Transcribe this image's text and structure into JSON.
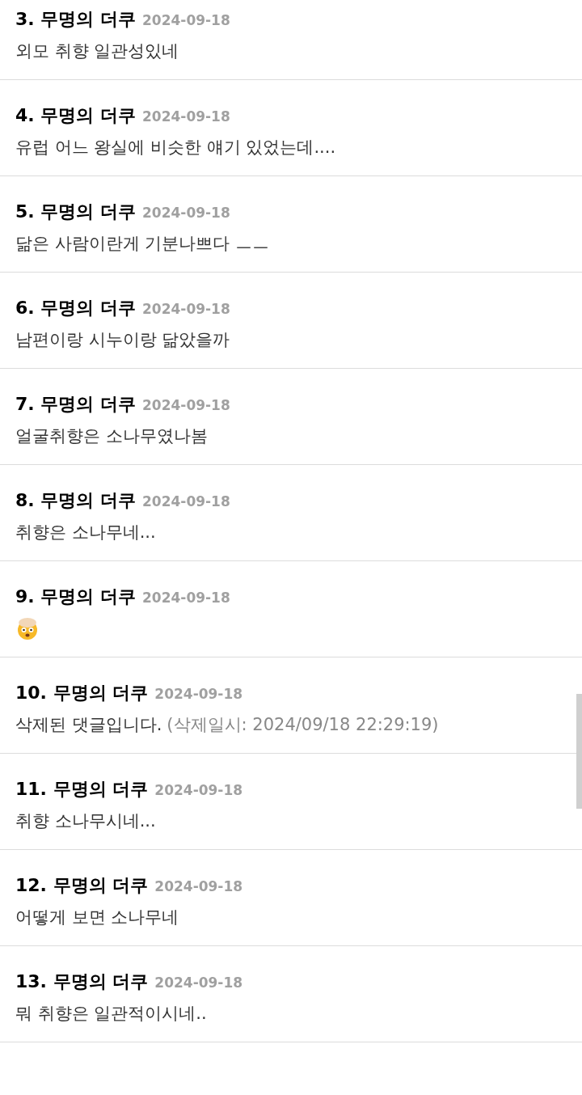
{
  "comments": [
    {
      "number": "3.",
      "author": "무명의 더쿠",
      "date": "2024-09-18",
      "kind": "text",
      "body": "외모 취향 일관성있네"
    },
    {
      "number": "4.",
      "author": "무명의 더쿠",
      "date": "2024-09-18",
      "kind": "text",
      "body": "유럽 어느 왕실에 비슷한 얘기 있었는데...."
    },
    {
      "number": "5.",
      "author": "무명의 더쿠",
      "date": "2024-09-18",
      "kind": "text",
      "body": "닮은 사람이란게 기분나쁘다 ㅡㅡ"
    },
    {
      "number": "6.",
      "author": "무명의 더쿠",
      "date": "2024-09-18",
      "kind": "text",
      "body": "남편이랑 시누이랑 닮았을까"
    },
    {
      "number": "7.",
      "author": "무명의 더쿠",
      "date": "2024-09-18",
      "kind": "text",
      "body": "얼굴취향은 소나무였나봄"
    },
    {
      "number": "8.",
      "author": "무명의 더쿠",
      "date": "2024-09-18",
      "kind": "text",
      "body": "취향은 소나무네..."
    },
    {
      "number": "9.",
      "author": "무명의 더쿠",
      "date": "2024-09-18",
      "kind": "emoji"
    },
    {
      "number": "10.",
      "author": "무명의 더쿠",
      "date": "2024-09-18",
      "kind": "deleted",
      "body": "삭제된 댓글입니다.",
      "note": "(삭제일시: 2024/09/18 22:29:19)"
    },
    {
      "number": "11.",
      "author": "무명의 더쿠",
      "date": "2024-09-18",
      "kind": "text",
      "body": "취향 소나무시네..."
    },
    {
      "number": "12.",
      "author": "무명의 더쿠",
      "date": "2024-09-18",
      "kind": "text",
      "body": "어떻게 보면 소나무네"
    },
    {
      "number": "13.",
      "author": "무명의 더쿠",
      "date": "2024-09-18",
      "kind": "text",
      "body": "뭐 취향은 일관적이시네.."
    }
  ]
}
